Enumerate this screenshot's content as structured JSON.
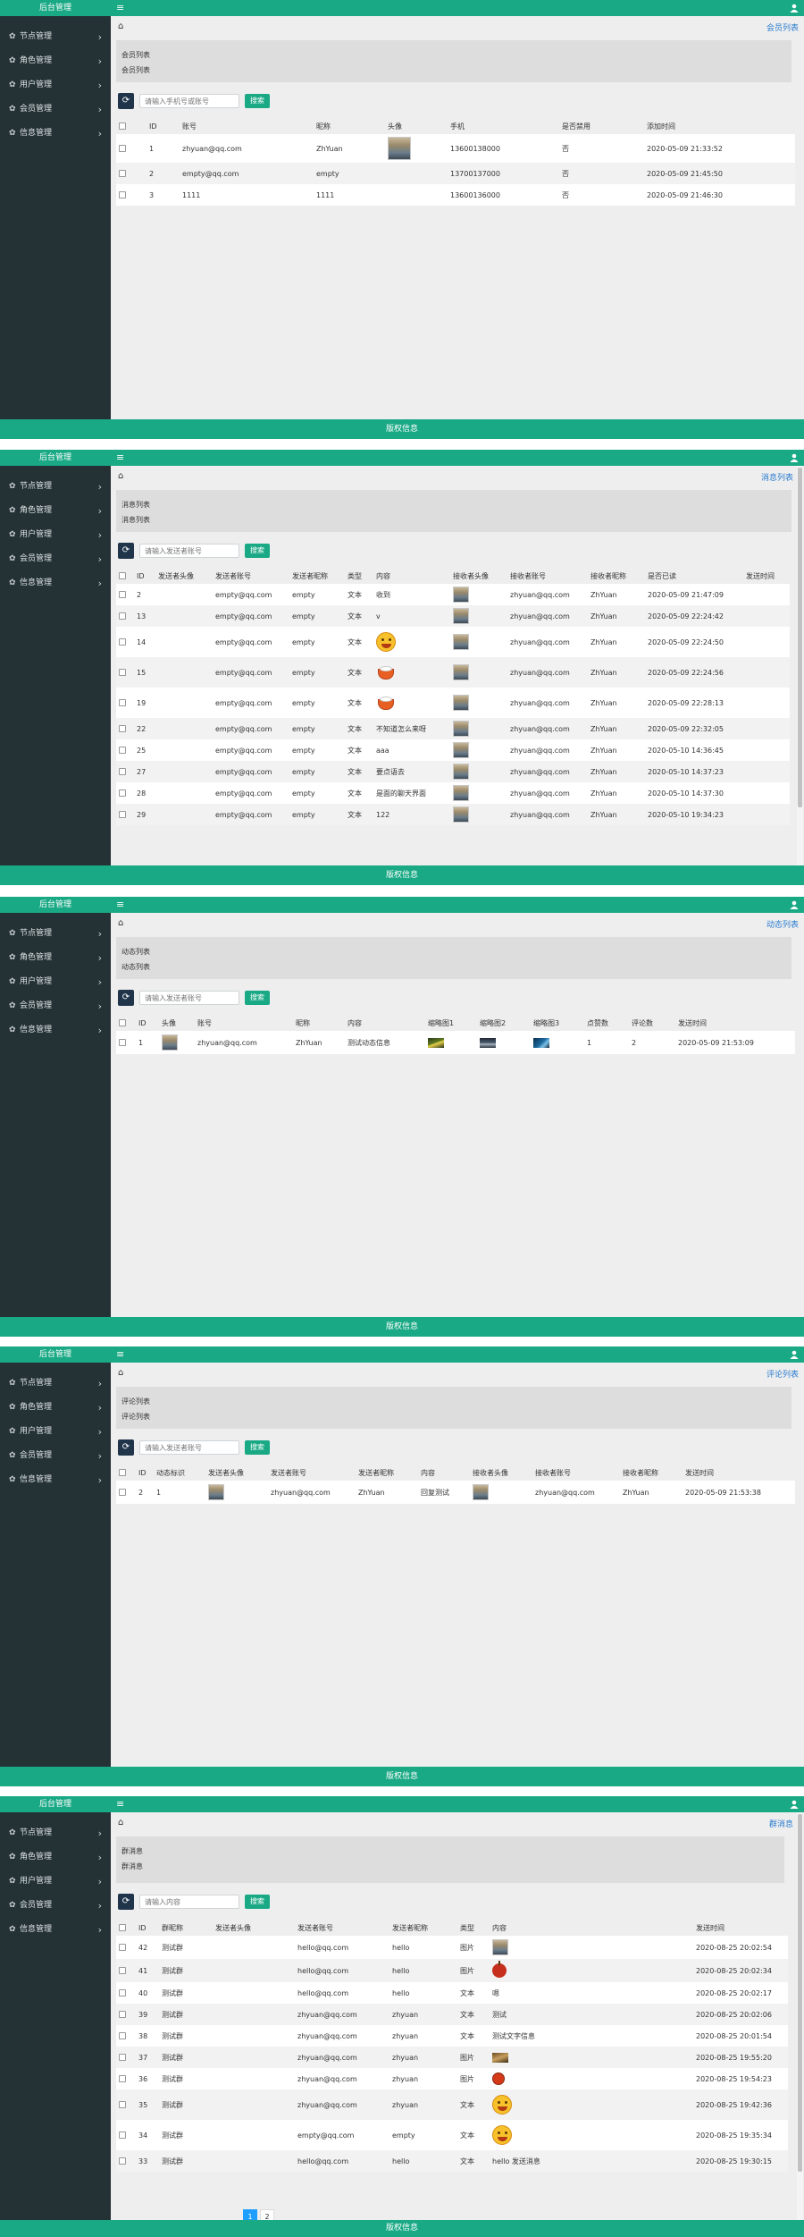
{
  "app": {
    "brand": "后台管理",
    "footer": "版权信息",
    "search_button": "搜索"
  },
  "sidebar": {
    "items": [
      {
        "label": "节点管理"
      },
      {
        "label": "角色管理"
      },
      {
        "label": "用户管理"
      },
      {
        "label": "会员管理"
      },
      {
        "label": "信息管理"
      }
    ]
  },
  "colors": {
    "brand": "#1aa985",
    "sidebar": "#243236",
    "link": "#2a7ccf"
  },
  "panels": [
    {
      "crumb": "会员列表",
      "title_lines": [
        "会员列表",
        "会员列表"
      ],
      "search_placeholder": "请输入手机号或账号",
      "headers": [
        "ID",
        "账号",
        "昵称",
        "头像",
        "手机",
        "是否禁用",
        "添加时间"
      ],
      "rows": [
        [
          "1",
          "zhyuan@qq.com",
          "ZhYuan",
          "",
          "13600138000",
          "否",
          "2020-05-09 21:33:52"
        ],
        [
          "2",
          "empty@qq.com",
          "empty",
          "",
          "13700137000",
          "否",
          "2020-05-09 21:45:50"
        ],
        [
          "3",
          "1111",
          "1111",
          "",
          "13600136000",
          "否",
          "2020-05-09 21:46:30"
        ]
      ]
    },
    {
      "crumb": "消息列表",
      "title_lines": [
        "消息列表",
        "消息列表"
      ],
      "search_placeholder": "请输入发送者账号",
      "headers": [
        "ID",
        "发送者头像",
        "发送者账号",
        "发送者昵称",
        "类型",
        "内容",
        "接收者头像",
        "接收者账号",
        "接收者昵称",
        "是否已读",
        "发送时间"
      ],
      "rows": [
        [
          "2",
          "",
          "empty@qq.com",
          "empty",
          "文本",
          "收到",
          "",
          "zhyuan@qq.com",
          "ZhYuan",
          "2020-05-09 21:47:09",
          ""
        ],
        [
          "13",
          "",
          "empty@qq.com",
          "empty",
          "文本",
          "v",
          "",
          "zhyuan@qq.com",
          "ZhYuan",
          "2020-05-09 22:24:42",
          ""
        ],
        [
          "14",
          "",
          "empty@qq.com",
          "empty",
          "文本",
          "",
          "",
          "zhyuan@qq.com",
          "ZhYuan",
          "2020-05-09 22:24:50",
          ""
        ],
        [
          "15",
          "",
          "empty@qq.com",
          "empty",
          "文本",
          "",
          "",
          "zhyuan@qq.com",
          "ZhYuan",
          "2020-05-09 22:24:56",
          ""
        ],
        [
          "19",
          "",
          "empty@qq.com",
          "empty",
          "文本",
          "",
          "",
          "zhyuan@qq.com",
          "ZhYuan",
          "2020-05-09 22:28:13",
          ""
        ],
        [
          "22",
          "",
          "empty@qq.com",
          "empty",
          "文本",
          "不知道怎么来呀",
          "",
          "zhyuan@qq.com",
          "ZhYuan",
          "2020-05-09 22:32:05",
          ""
        ],
        [
          "25",
          "",
          "empty@qq.com",
          "empty",
          "文本",
          "aaa",
          "",
          "zhyuan@qq.com",
          "ZhYuan",
          "2020-05-10 14:36:45",
          ""
        ],
        [
          "27",
          "",
          "empty@qq.com",
          "empty",
          "文本",
          "要点语去",
          "",
          "zhyuan@qq.com",
          "ZhYuan",
          "2020-05-10 14:37:23",
          ""
        ],
        [
          "28",
          "",
          "empty@qq.com",
          "empty",
          "文本",
          "是面的聊天界面",
          "",
          "zhyuan@qq.com",
          "ZhYuan",
          "2020-05-10 14:37:30",
          ""
        ],
        [
          "29",
          "",
          "empty@qq.com",
          "empty",
          "文本",
          "122",
          "",
          "zhyuan@qq.com",
          "ZhYuan",
          "2020-05-10 19:34:23",
          ""
        ]
      ],
      "content_icons": {
        "2": "smile-emoji-icon",
        "3": "teacup-icon",
        "4": "teacup-icon"
      }
    },
    {
      "crumb": "动态列表",
      "title_lines": [
        "动态列表",
        "动态列表"
      ],
      "search_placeholder": "请输入发送者账号",
      "headers": [
        "ID",
        "头像",
        "账号",
        "昵称",
        "内容",
        "缩略图1",
        "缩略图2",
        "缩略图3",
        "点赞数",
        "评论数",
        "发送时间"
      ],
      "rows": [
        [
          "1",
          "",
          "zhyuan@qq.com",
          "ZhYuan",
          "测试动态信息",
          "",
          "",
          "",
          "1",
          "2",
          "2020-05-09 21:53:09"
        ]
      ]
    },
    {
      "crumb": "评论列表",
      "title_lines": [
        "评论列表",
        "评论列表"
      ],
      "search_placeholder": "请输入发送者账号",
      "headers": [
        "ID",
        "动态标识",
        "发送者头像",
        "发送者账号",
        "发送者昵称",
        "内容",
        "接收者头像",
        "接收者账号",
        "接收者昵称",
        "发送时间"
      ],
      "rows": [
        [
          "2",
          "1",
          "",
          "zhyuan@qq.com",
          "ZhYuan",
          "回复测试",
          "",
          "zhyuan@qq.com",
          "ZhYuan",
          "2020-05-09 21:53:38"
        ]
      ]
    },
    {
      "crumb": "群消息",
      "title_lines": [
        "群消息",
        "群消息"
      ],
      "search_placeholder": "请输入内容",
      "headers": [
        "ID",
        "群昵称",
        "发送者头像",
        "发送者账号",
        "发送者昵称",
        "类型",
        "内容",
        "发送时间"
      ],
      "rows": [
        [
          "42",
          "测试群",
          "",
          "hello@qq.com",
          "hello",
          "图片",
          "",
          "2020-08-25 20:02:54"
        ],
        [
          "41",
          "测试群",
          "",
          "hello@qq.com",
          "hello",
          "图片",
          "",
          "2020-08-25 20:02:34"
        ],
        [
          "40",
          "测试群",
          "",
          "hello@qq.com",
          "hello",
          "文本",
          "嗯",
          "2020-08-25 20:02:17"
        ],
        [
          "39",
          "测试群",
          "",
          "zhyuan@qq.com",
          "zhyuan",
          "文本",
          "测试",
          "2020-08-25 20:02:06"
        ],
        [
          "38",
          "测试群",
          "",
          "zhyuan@qq.com",
          "zhyuan",
          "文本",
          "测试文字信息",
          "2020-08-25 20:01:54"
        ],
        [
          "37",
          "测试群",
          "",
          "zhyuan@qq.com",
          "zhyuan",
          "图片",
          "",
          "2020-08-25 19:55:20"
        ],
        [
          "36",
          "测试群",
          "",
          "zhyuan@qq.com",
          "zhyuan",
          "图片",
          "",
          "2020-08-25 19:54:23"
        ],
        [
          "35",
          "测试群",
          "",
          "zhyuan@qq.com",
          "zhyuan",
          "文本",
          "",
          "2020-08-25 19:42:36"
        ],
        [
          "34",
          "测试群",
          "",
          "empty@qq.com",
          "empty",
          "文本",
          "",
          "2020-08-25 19:35:34"
        ],
        [
          "33",
          "测试群",
          "",
          "hello@qq.com",
          "hello",
          "文本",
          "hello 发送消息",
          "2020-08-25 19:30:15"
        ]
      ],
      "pager": [
        "1",
        "2"
      ]
    }
  ]
}
